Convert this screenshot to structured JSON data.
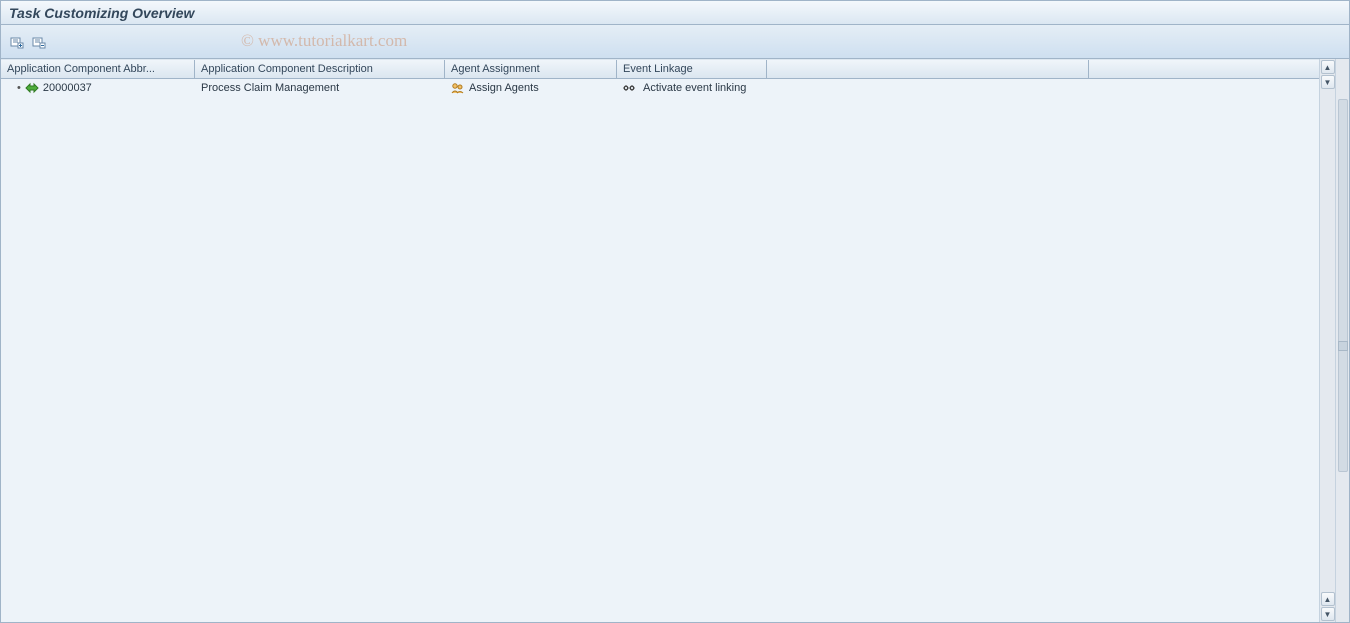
{
  "title": "Task Customizing Overview",
  "watermark": "© www.tutorialkart.com",
  "toolbar": {
    "expand_all": "Expand All",
    "collapse_all": "Collapse All"
  },
  "columns": {
    "col0": "Application Component Abbr...",
    "col1": "Application Component Description",
    "col2": "Agent Assignment",
    "col3": "Event Linkage",
    "col4": ""
  },
  "rows": [
    {
      "abbr": "20000037",
      "desc": "Process Claim Management",
      "agent": "Assign Agents",
      "event": "Activate event linking"
    }
  ]
}
